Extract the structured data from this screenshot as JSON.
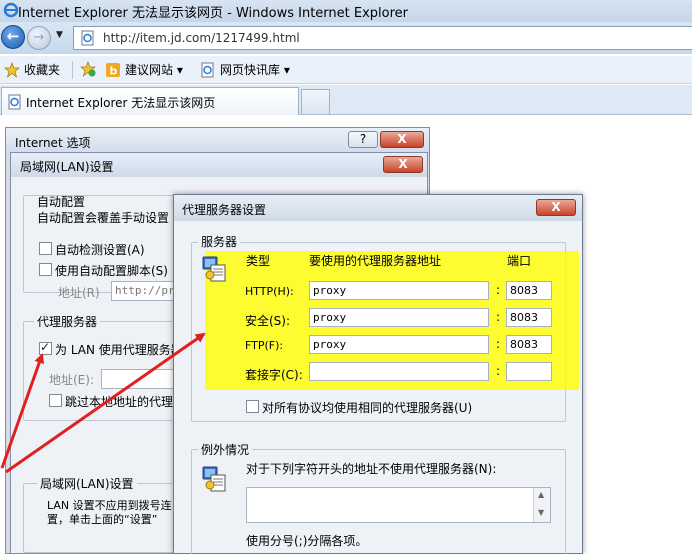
{
  "browser": {
    "title": "Internet Explorer 无法显示该网页 - Windows Internet Explorer",
    "url": "http://item.jd.com/1217499.html",
    "favorites_label": "收藏夹",
    "fav_links": [
      "建议网站 ▾",
      "网页快讯库 ▾"
    ],
    "tab_title": "Internet Explorer 无法显示该网页"
  },
  "inet_options": {
    "title": "Internet 选项",
    "help_btn": "?",
    "close_btn": "X"
  },
  "lan": {
    "title": "局域网(LAN)设置",
    "close_btn": "X",
    "auto_group": "自动配置",
    "auto_desc": "自动配置会覆盖手动设置",
    "auto_detect": "自动检测设置(A)",
    "auto_script": "使用自动配置脚本(S)",
    "address_label": "地址(R)",
    "address_value": "http://pro",
    "proxy_group": "代理服务器",
    "use_proxy": "为 LAN 使用代理服务器",
    "proxy_addr_label": "地址(E):",
    "bypass_local": "跳过本地地址的代理",
    "lan_group2": "局域网(LAN)设置",
    "lan_note_1": "LAN 设置不应用到拨号连",
    "lan_note_2": "置，单击上面的“设置”"
  },
  "proxy": {
    "title": "代理服务器设置",
    "close_btn": "X",
    "servers_group": "服务器",
    "col_type": "类型",
    "col_addr": "要使用的代理服务器地址",
    "col_port": "端口",
    "rows": [
      {
        "type": "HTTP(H):",
        "addr": "proxy",
        "port": "8083"
      },
      {
        "type": "安全(S):",
        "addr": "proxy",
        "port": "8083"
      },
      {
        "type": "FTP(F):",
        "addr": "proxy",
        "port": "8083"
      },
      {
        "type": "套接字(C):",
        "addr": "",
        "port": ""
      }
    ],
    "colon": ":",
    "same_all": "对所有协议均使用相同的代理服务器(U)",
    "exceptions_group": "例外情况",
    "exceptions_desc": "对于下列字符开头的地址不使用代理服务器(N):",
    "separator_note": "使用分号(;)分隔各项。"
  },
  "colors": {
    "highlight": "#ffff00",
    "arrow": "#e02020"
  }
}
